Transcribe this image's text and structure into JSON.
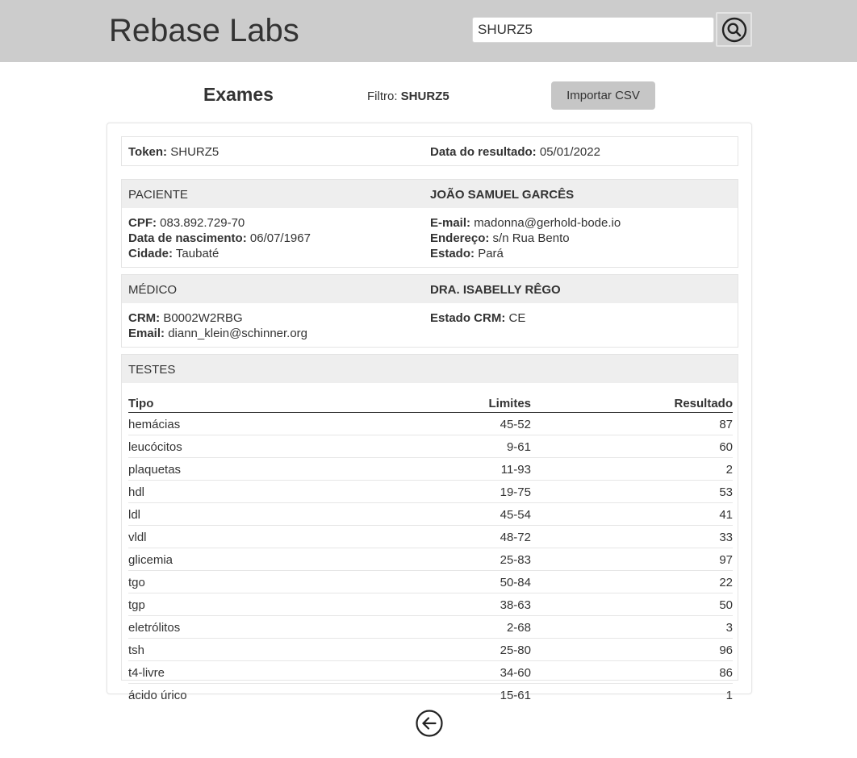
{
  "header": {
    "brand": "Rebase Labs",
    "search_value": "SHURZ5",
    "search_icon": "search-icon"
  },
  "toolbar": {
    "title": "Exames",
    "filter_label": "Filtro:",
    "filter_value": "SHURZ5",
    "import_label": "Importar CSV"
  },
  "exam": {
    "token_label": "Token:",
    "token_value": "SHURZ5",
    "date_label": "Data do resultado:",
    "date_value": "05/01/2022"
  },
  "patient": {
    "section_label": "PACIENTE",
    "name": "JOÃO SAMUEL GARCÊS",
    "cpf_label": "CPF:",
    "cpf_value": "083.892.729-70",
    "birth_label": "Data de nascimento:",
    "birth_value": "06/07/1967",
    "city_label": "Cidade:",
    "city_value": "Taubaté",
    "email_label": "E-mail:",
    "email_value": "madonna@gerhold-bode.io",
    "address_label": "Endereço:",
    "address_value": "s/n Rua Bento",
    "state_label": "Estado:",
    "state_value": "Pará"
  },
  "doctor": {
    "section_label": "MÉDICO",
    "name": "DRA. ISABELLY RÊGO",
    "crm_label": "CRM:",
    "crm_value": "B0002W2RBG",
    "email_label": "Email:",
    "email_value": "diann_klein@schinner.org",
    "crm_state_label": "Estado CRM:",
    "crm_state_value": "CE"
  },
  "tests": {
    "section_label": "TESTES",
    "columns": [
      "Tipo",
      "Limites",
      "Resultado"
    ],
    "rows": [
      {
        "tipo": "hemácias",
        "limites": "45-52",
        "resultado": "87"
      },
      {
        "tipo": "leucócitos",
        "limites": "9-61",
        "resultado": "60"
      },
      {
        "tipo": "plaquetas",
        "limites": "11-93",
        "resultado": "2"
      },
      {
        "tipo": "hdl",
        "limites": "19-75",
        "resultado": "53"
      },
      {
        "tipo": "ldl",
        "limites": "45-54",
        "resultado": "41"
      },
      {
        "tipo": "vldl",
        "limites": "48-72",
        "resultado": "33"
      },
      {
        "tipo": "glicemia",
        "limites": "25-83",
        "resultado": "97"
      },
      {
        "tipo": "tgo",
        "limites": "50-84",
        "resultado": "22"
      },
      {
        "tipo": "tgp",
        "limites": "38-63",
        "resultado": "50"
      },
      {
        "tipo": "eletrólitos",
        "limites": "2-68",
        "resultado": "3"
      },
      {
        "tipo": "tsh",
        "limites": "25-80",
        "resultado": "96"
      },
      {
        "tipo": "t4-livre",
        "limites": "34-60",
        "resultado": "86"
      },
      {
        "tipo": "ácido úrico",
        "limites": "15-61",
        "resultado": "1"
      }
    ]
  },
  "footer": {
    "back_icon": "arrow-left-circle-icon"
  }
}
